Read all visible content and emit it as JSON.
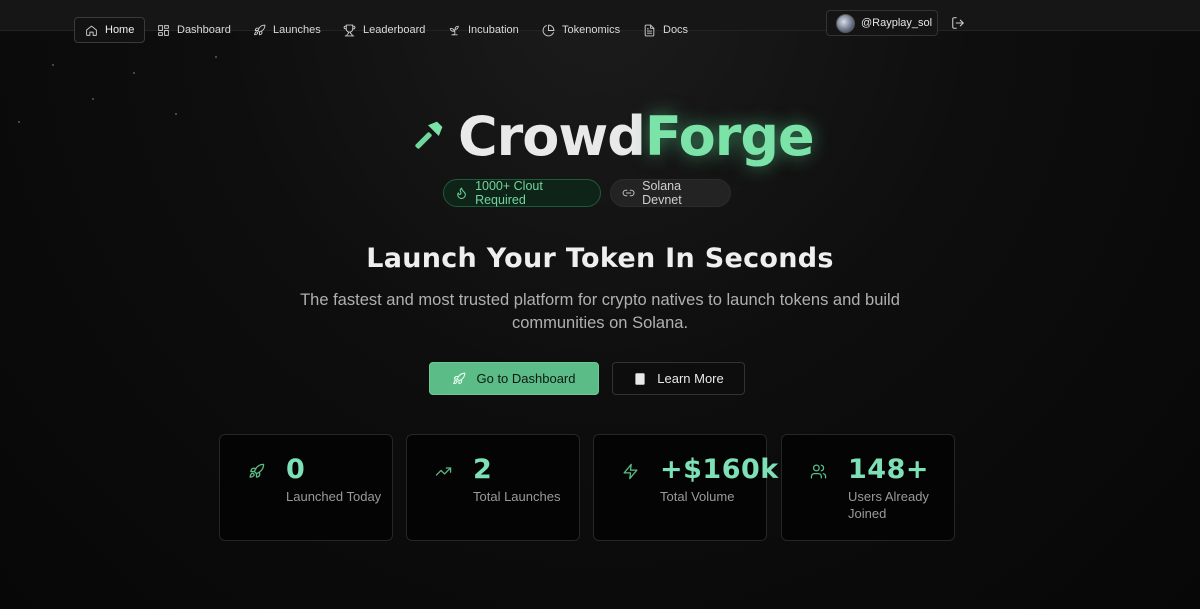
{
  "nav": {
    "items": [
      {
        "label": "Home",
        "icon": "home-icon",
        "active": true
      },
      {
        "label": "Dashboard",
        "icon": "grid-icon"
      },
      {
        "label": "Launches",
        "icon": "rocket-icon"
      },
      {
        "label": "Leaderboard",
        "icon": "trophy-icon"
      },
      {
        "label": "Incubation",
        "icon": "sprout-icon"
      },
      {
        "label": "Tokenomics",
        "icon": "pie-icon"
      },
      {
        "label": "Docs",
        "icon": "document-icon"
      }
    ],
    "user": {
      "handle": "@Rayplay_sol"
    }
  },
  "hero": {
    "brand_part1": "Crowd",
    "brand_part2": "Forge",
    "badges": [
      {
        "label": "1000+ Clout Required",
        "icon": "flame-icon"
      },
      {
        "label": "Solana Devnet",
        "icon": "link-icon"
      }
    ],
    "headline": "Launch Your Token In Seconds",
    "subtext": "The fastest and most trusted platform for crypto natives to launch tokens and build communities on Solana.",
    "primary_button": "Go to Dashboard",
    "secondary_button": "Learn More"
  },
  "stats": [
    {
      "value": "0",
      "label": "Launched Today",
      "icon": "rocket-icon"
    },
    {
      "value": "2",
      "label": "Total Launches",
      "icon": "trending-up-icon"
    },
    {
      "value": "+$160k",
      "label": "Total Volume",
      "icon": "bolt-icon"
    },
    {
      "value": "148+",
      "label": "Users Already Joined",
      "icon": "users-icon"
    }
  ],
  "colors": {
    "accent": "#5bbc87",
    "accent_text": "#7de0b6",
    "brand_glow": "#7be3a8",
    "background": "#0b0b0b"
  }
}
